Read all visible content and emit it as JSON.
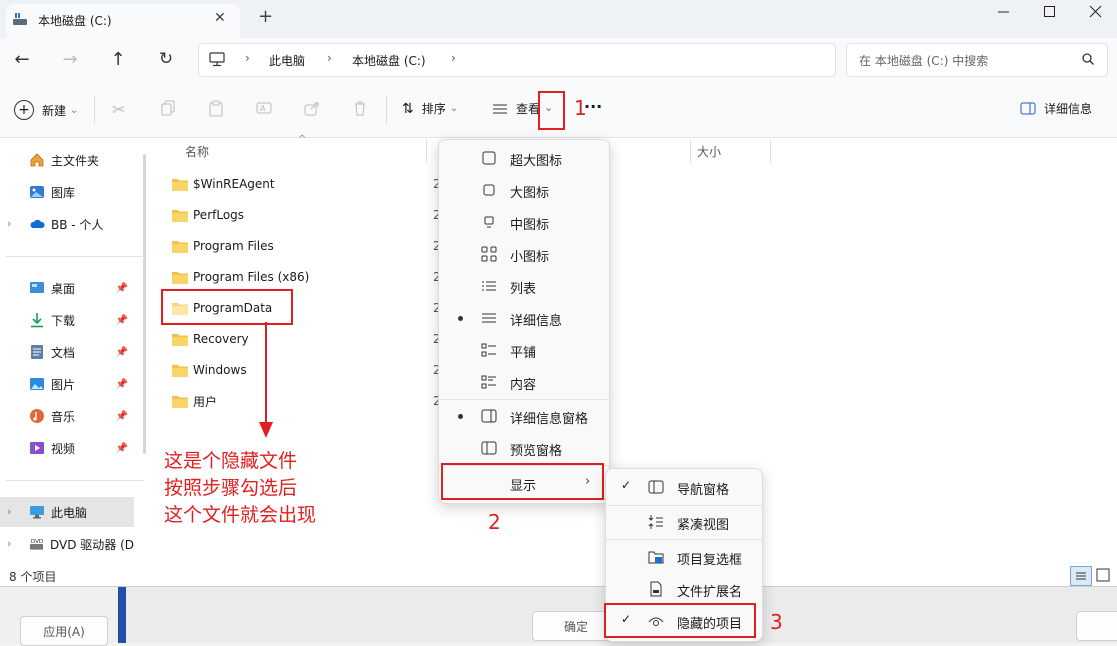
{
  "window": {
    "tab_title": "本地磁盘 (C:)",
    "new_tab": "+"
  },
  "address": {
    "path": [
      "此电脑",
      "本地磁盘 (C:)"
    ],
    "search_placeholder": "在 本地磁盘 (C:) 中搜索"
  },
  "toolbar": {
    "new_label": "新建",
    "sort_label": "排序",
    "view_label": "查看",
    "more_label": "···",
    "details_label": "详细信息"
  },
  "sidebar": {
    "items": [
      {
        "label": "主文件夹",
        "icon": "home-icon"
      },
      {
        "label": "图库",
        "icon": "gallery-icon"
      },
      {
        "label": "BB - 个人",
        "icon": "cloud-icon"
      },
      {
        "label": "桌面",
        "icon": "desktop-icon"
      },
      {
        "label": "下载",
        "icon": "download-icon"
      },
      {
        "label": "文档",
        "icon": "document-icon"
      },
      {
        "label": "图片",
        "icon": "pictures-icon"
      },
      {
        "label": "音乐",
        "icon": "music-icon"
      },
      {
        "label": "视频",
        "icon": "video-icon"
      },
      {
        "label": "此电脑",
        "icon": "computer-icon"
      },
      {
        "label": "DVD 驱动器 (D",
        "icon": "dvd-icon"
      }
    ]
  },
  "columns": {
    "name": "名称",
    "size": "大小"
  },
  "files": [
    "$WinREAgent",
    "PerfLogs",
    "Program Files",
    "Program Files (x86)",
    "ProgramData",
    "Recovery",
    "Windows",
    "用户"
  ],
  "date_stub": "2",
  "status": {
    "count": "8 个项目"
  },
  "view_menu": {
    "items": [
      "超大图标",
      "大图标",
      "中图标",
      "小图标",
      "列表",
      "详细信息",
      "平铺",
      "内容"
    ],
    "panes": [
      "详细信息窗格",
      "预览窗格"
    ],
    "show_label": "显示"
  },
  "show_menu": {
    "items": [
      "导航窗格",
      "紧凑视图",
      "项目复选框",
      "文件扩展名",
      "隐藏的项目"
    ]
  },
  "annotations": {
    "step1": "1",
    "step2": "2",
    "step3": "3",
    "note_line1": "这是个隐藏文件",
    "note_line2": "按照步骤勾选后",
    "note_line3": "这个文件就会出现"
  },
  "background_dialog": {
    "apply": "应用(A)",
    "ok": "确定"
  },
  "colors": {
    "annotation": "#e02020",
    "accent": "#1f4fa8"
  }
}
